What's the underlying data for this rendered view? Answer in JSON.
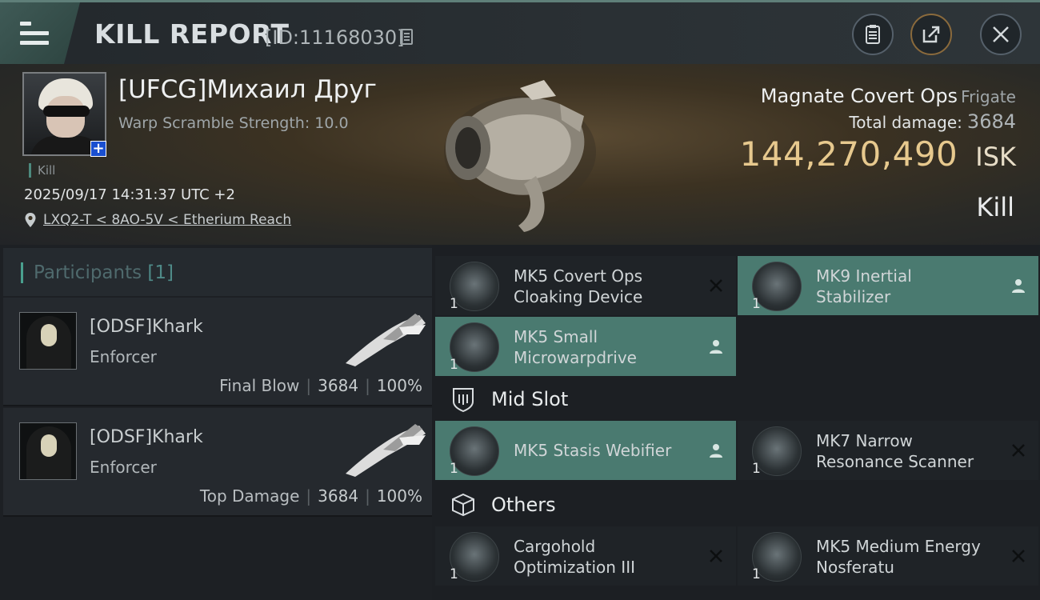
{
  "header": {
    "title": "KILL REPORT",
    "report_id": "[ID:11168030]"
  },
  "victim": {
    "name": "[UFCG]Михаил Друг",
    "warp_scramble": "Warp Scramble Strength: 10.0",
    "kill_tag": "Kill",
    "datetime": "2025/09/17 14:31:37 UTC +2",
    "location": "LXQ2-T < 8AO-5V < Etherium Reach"
  },
  "ship": {
    "name": "Magnate Covert Ops",
    "class": "Frigate",
    "total_damage_label": "Total damage:",
    "total_damage": "3684",
    "isk_value": "144,270,490",
    "isk_unit": "ISK",
    "result": "Kill"
  },
  "participants": {
    "title": "Participants",
    "count": "[1]",
    "rows": [
      {
        "name": "[ODSF]Khark",
        "ship": "Enforcer",
        "label": "Final Blow",
        "damage": "3684",
        "percent": "100%"
      },
      {
        "name": "[ODSF]Khark",
        "ship": "Enforcer",
        "label": "Top Damage",
        "damage": "3684",
        "percent": "100%"
      }
    ]
  },
  "modules": {
    "high": [
      {
        "name": "MK5 Covert Ops Cloaking Device",
        "qty": "1",
        "status": "destroyed",
        "icon": "cloak-icon"
      },
      {
        "name": "MK9 Inertial Stabilizer",
        "qty": "1",
        "status": "dropped",
        "icon": "stabilizer-icon"
      },
      {
        "name": "MK5 Small Microwarpdrive",
        "qty": "1",
        "status": "dropped",
        "icon": "mwd-icon"
      }
    ],
    "mid_title": "Mid Slot",
    "mid": [
      {
        "name": "MK5 Stasis Webifier",
        "qty": "1",
        "status": "dropped",
        "icon": "webifier-icon"
      },
      {
        "name": "MK7 Narrow Resonance Scanner",
        "qty": "1",
        "status": "destroyed",
        "icon": "scanner-icon"
      }
    ],
    "others_title": "Others",
    "others": [
      {
        "name": "Cargohold Optimization III",
        "qty": "1",
        "status": "destroyed",
        "icon": "cargohold-icon"
      },
      {
        "name": "MK5 Medium Energy Nosferatu",
        "qty": "1",
        "status": "destroyed",
        "icon": "nosferatu-icon"
      }
    ]
  },
  "colors": {
    "accent": "#4a7a70",
    "isk": "#e7c98e",
    "teal": "#4aa08f"
  }
}
